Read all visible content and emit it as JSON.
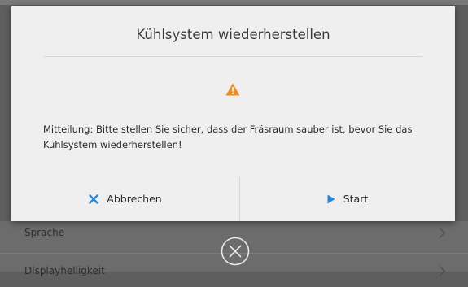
{
  "dialog": {
    "title": "Kühlsystem wiederherstellen",
    "icon": "warning-icon",
    "message": "Mitteilung: Bitte stellen Sie sicher, dass der Fräsraum sauber ist, bevor Sie das Kühlsystem wiederherstellen!",
    "cancel_label": "Abbrechen",
    "cancel_icon": "close-x-icon",
    "start_label": "Start",
    "start_icon": "play-icon"
  },
  "background_list": {
    "items": [
      {
        "label": "Sprache"
      },
      {
        "label": "Displayhelligkeit"
      }
    ]
  },
  "colors": {
    "warning": "#f28a1e",
    "accent": "#2a86d6",
    "dialog_bg": "#efefef"
  }
}
